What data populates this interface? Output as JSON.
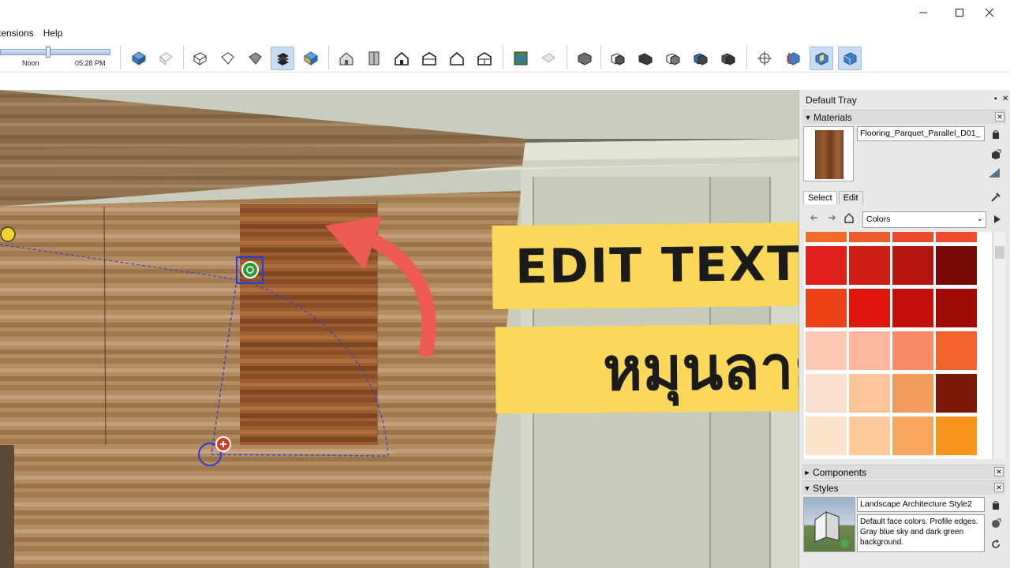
{
  "menu": {
    "items": [
      "tensions",
      "Help"
    ]
  },
  "shadow": {
    "label_mid": "Noon",
    "label_time": "05:28 PM",
    "level": 0.43
  },
  "overlay": {
    "title_en": "EDIT TEXTURE",
    "title_th": "หมุนลาย"
  },
  "tray": {
    "title": "Default Tray",
    "materials": {
      "header": "Materials",
      "name": "Flooring_Parquet_Parallel_D01_",
      "tabs": [
        "Select",
        "Edit"
      ],
      "library": "Colors",
      "swatches": [
        [
          "#f06a2a",
          "#ee5b2c",
          "#e94a2c",
          "#f24a2f"
        ],
        [
          "#e11f1a",
          "#cf1d17",
          "#b4150f",
          "#7a0a05"
        ],
        [
          "#f04018",
          "#e0170f",
          "#c50f0c",
          "#a00a07"
        ],
        [
          "#fcc9b3",
          "#fdb7a0",
          "#f98b68",
          "#f2622b"
        ],
        [
          "#f9e0cf",
          "#fcc59c",
          "#f29b5f",
          "#7b1a08"
        ],
        [
          "#fde3cb",
          "#fcc99a",
          "#f9a65e",
          "#f7941d"
        ],
        [
          "#f07d12",
          "#d8660c",
          "#b35208",
          "#7a3506"
        ]
      ]
    },
    "components": {
      "header": "Components"
    },
    "styles": {
      "header": "Styles",
      "name": "Landscape Architecture Style2",
      "description": "Default face colors. Profile edges. Gray blue sky and dark green background."
    }
  }
}
